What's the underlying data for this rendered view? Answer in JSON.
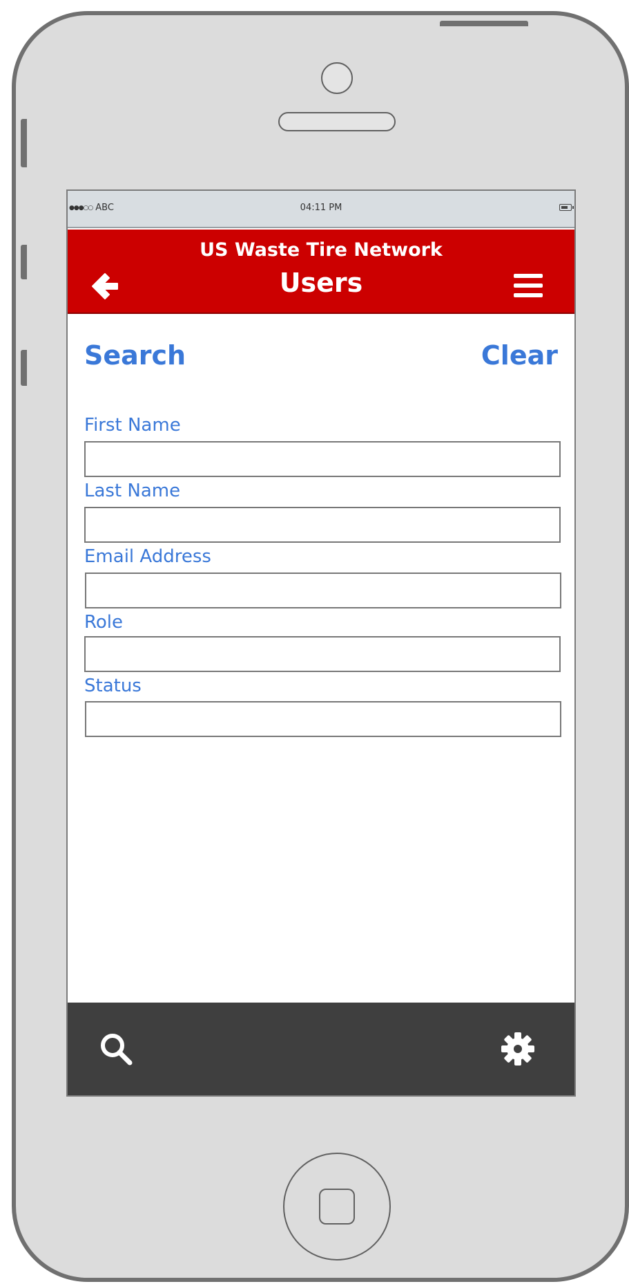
{
  "status_bar": {
    "signal_dots": "●●●○○",
    "carrier": "ABC",
    "time": "04:11 PM",
    "battery_icon": "battery-icon"
  },
  "header": {
    "app_title": "US Waste Tire Network",
    "page_title": "Users",
    "back_icon": "arrow-left-icon",
    "menu_icon": "hamburger-menu-icon",
    "background_color": "#cc0000"
  },
  "actions": {
    "search_label": "Search",
    "clear_label": "Clear",
    "link_color": "#3a78d8"
  },
  "form": {
    "fields": [
      {
        "label": "First Name",
        "value": "",
        "placeholder": ""
      },
      {
        "label": "Last Name",
        "value": "",
        "placeholder": ""
      },
      {
        "label": "Email Address",
        "value": "",
        "placeholder": ""
      },
      {
        "label": "Role",
        "value": "",
        "placeholder": ""
      },
      {
        "label": "Status",
        "value": "",
        "placeholder": ""
      }
    ]
  },
  "tab_bar": {
    "background_color": "#3f3f3f",
    "items": [
      {
        "icon": "search-icon"
      },
      {
        "icon": "gear-icon"
      }
    ]
  }
}
